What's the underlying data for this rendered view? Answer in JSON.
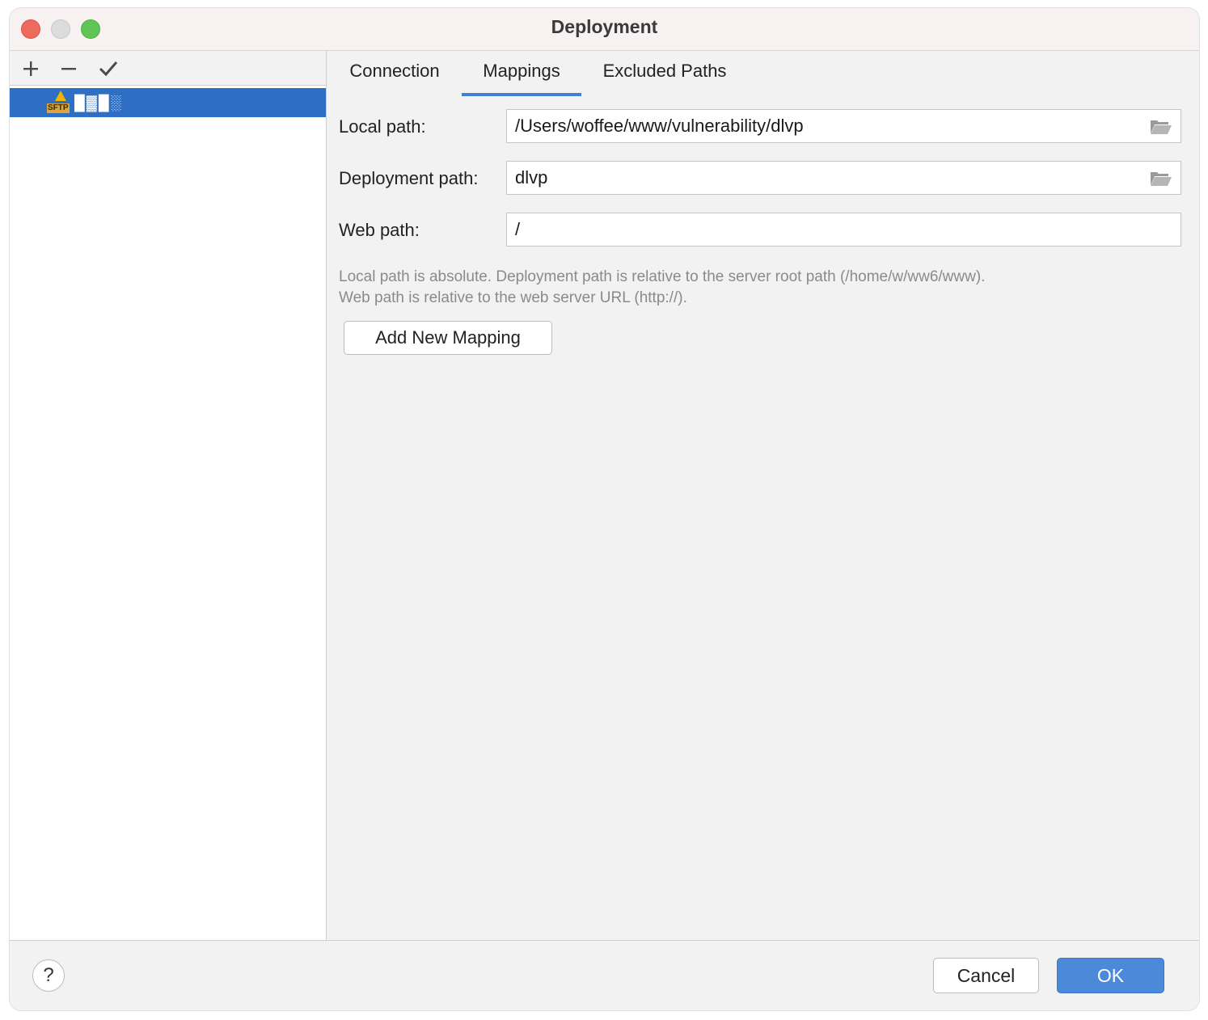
{
  "window": {
    "title": "Deployment"
  },
  "toolbar": {
    "add_icon": "plus-icon",
    "remove_icon": "minus-icon",
    "apply_icon": "check-icon"
  },
  "server_list": {
    "items": [
      {
        "type_label": "SFTP",
        "name": "█▓█░",
        "selected": true,
        "icon": "sftp-server-warning-icon"
      }
    ]
  },
  "tabs": [
    {
      "label": "Connection",
      "active": false
    },
    {
      "label": "Mappings",
      "active": true
    },
    {
      "label": "Excluded Paths",
      "active": false
    }
  ],
  "mappings": {
    "local_path_label": "Local path:",
    "local_path_value": "/Users/woffee/www/vulnerability/dlvp",
    "deployment_path_label": "Deployment path:",
    "deployment_path_value": "dlvp",
    "web_path_label": "Web path:",
    "web_path_value": "/",
    "hint_line1": "Local path is absolute. Deployment path is relative to the server root path (/home/w/ww6/www).",
    "hint_line2": "Web path is relative to the web server URL (http://).",
    "add_button": "Add New Mapping"
  },
  "footer": {
    "help": "?",
    "cancel": "Cancel",
    "ok": "OK"
  },
  "colors": {
    "accent": "#4a8ad9",
    "selection": "#2f6fc3",
    "tab_underline": "#3f80d8",
    "close": "#ed6a5e",
    "maximize": "#61c454"
  }
}
